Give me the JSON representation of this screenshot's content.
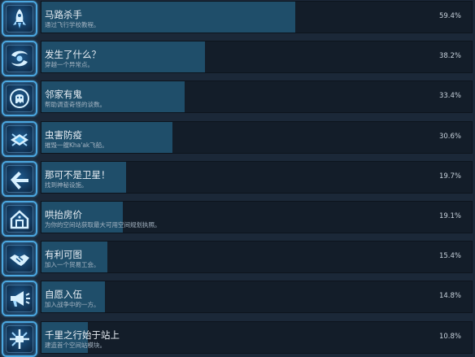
{
  "achievements": [
    {
      "title": "马路杀手",
      "description": "通过飞行学校教程。",
      "percent_label": "59.4%",
      "percent": 59.4,
      "icon": "rocket-icon"
    },
    {
      "title": "发生了什么？",
      "description": "穿越一个异常点。",
      "percent_label": "38.2%",
      "percent": 38.2,
      "icon": "vortex-icon"
    },
    {
      "title": "邻家有鬼",
      "description": "帮助调查奇怪的谈数。",
      "percent_label": "33.4%",
      "percent": 33.4,
      "icon": "ghost-icon"
    },
    {
      "title": "虫害防疫",
      "description": "摧毁一艘Kha'ak飞船。",
      "percent_label": "30.6%",
      "percent": 30.6,
      "icon": "bug-ship-icon"
    },
    {
      "title": "那可不是卫星！",
      "description": "找到神秘设施。",
      "percent_label": "19.7%",
      "percent": 19.7,
      "icon": "satellite-icon"
    },
    {
      "title": "哄抬房价",
      "description": "为你的空间站获取最大可用空间规划执照。",
      "percent_label": "19.1%",
      "percent": 19.1,
      "icon": "house-icon"
    },
    {
      "title": "有利可图",
      "description": "加入一个贸易工会。",
      "percent_label": "15.4%",
      "percent": 15.4,
      "icon": "handshake-icon"
    },
    {
      "title": "自愿入伍",
      "description": "加入战争中的一方。",
      "percent_label": "14.8%",
      "percent": 14.8,
      "icon": "megaphone-icon"
    },
    {
      "title": "千里之行始于站上",
      "description": "建造首个空间站模块。",
      "percent_label": "10.8%",
      "percent": 10.8,
      "icon": "station-icon"
    }
  ],
  "colors": {
    "background": "#1b2838",
    "bar_fill": "#1f4e6a",
    "icon_border": "#4ba7e0"
  }
}
